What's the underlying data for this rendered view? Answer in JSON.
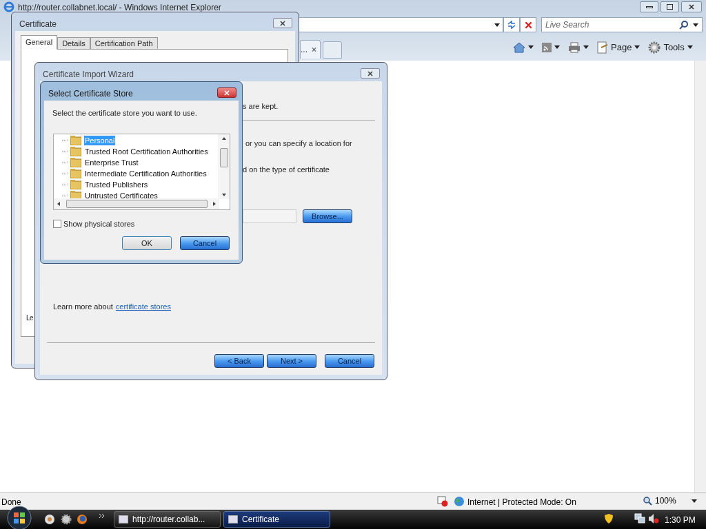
{
  "browser": {
    "title": "http://router.collabnet.local/ - Windows Internet Explorer",
    "search_placeholder": "Live Search",
    "tab_label": "...",
    "toolbar": [
      {
        "kind": "home"
      },
      {
        "kind": "feeds"
      },
      {
        "kind": "print"
      },
      {
        "kind": "page",
        "label": "Page"
      },
      {
        "kind": "tools",
        "label": "Tools"
      }
    ],
    "status": "Done",
    "zone": "Internet | Protected Mode: On",
    "zoom": "100%"
  },
  "certificate": {
    "title": "Certificate",
    "tabs": [
      {
        "label": "General",
        "selected": true
      },
      {
        "label": "Details",
        "selected": false
      },
      {
        "label": "Certification Path",
        "selected": false
      }
    ],
    "hidden_text": "Le"
  },
  "wizard": {
    "title": "Certificate Import Wizard",
    "lines": [
      "s are kept.",
      "or you can specify a location for",
      "d on the type of certificate"
    ],
    "browse": "Browse...",
    "learn_prefix": "Learn more about",
    "learn_link": "certificate stores",
    "buttons": [
      "< Back",
      "Next >",
      "Cancel"
    ]
  },
  "store_dialog": {
    "title": "Select Certificate Store",
    "prompt": "Select the certificate store you want to use.",
    "stores": [
      {
        "label": "Personal",
        "selected": true
      },
      {
        "label": "Trusted Root Certification Authorities",
        "selected": false
      },
      {
        "label": "Enterprise Trust",
        "selected": false
      },
      {
        "label": "Intermediate Certification Authorities",
        "selected": false
      },
      {
        "label": "Trusted Publishers",
        "selected": false
      },
      {
        "label": "Untrusted Certificates",
        "selected": false
      }
    ],
    "show_physical": {
      "label": "Show physical stores",
      "checked": false
    },
    "ok": "OK",
    "cancel": "Cancel"
  },
  "taskbar": {
    "items": [
      {
        "label": "http://router.collab...",
        "selected": false
      },
      {
        "label": "Certificate",
        "selected": true
      }
    ],
    "clock": "1:30 PM"
  }
}
